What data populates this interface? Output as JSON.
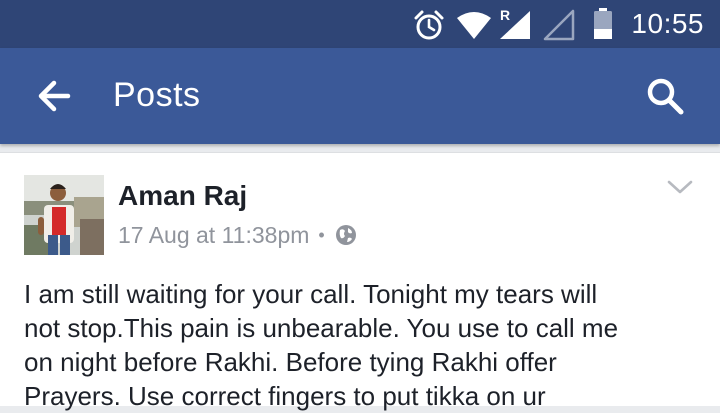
{
  "status_bar": {
    "time": "10:55",
    "icons": [
      "alarm-icon",
      "wifi-icon",
      "signal-roaming-icon",
      "signal-empty-icon",
      "battery-icon"
    ],
    "roaming_label": "R"
  },
  "app_bar": {
    "title": "Posts",
    "back_icon": "arrow-left-icon",
    "search_icon": "search-icon",
    "color": "#3b5998"
  },
  "post": {
    "author": "Aman Raj",
    "timestamp": "17 Aug at 11:38pm",
    "separator": "•",
    "privacy_icon": "globe-icon",
    "menu_icon": "chevron-down-icon",
    "text_lines": [
      "I am still waiting for your call. Tonight my tears will",
      "not stop.This pain is unbearable. You use to call me",
      "on night before Rakhi. Before tying Rakhi offer",
      "Prayers. Use correct fingers to put tikka on ur"
    ]
  }
}
